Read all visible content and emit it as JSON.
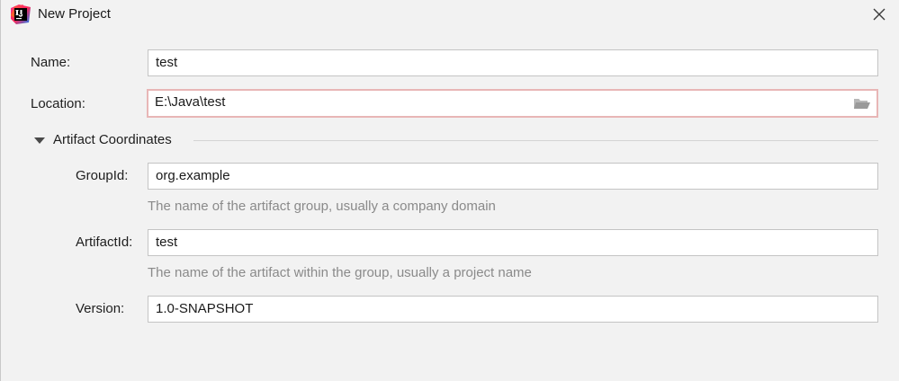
{
  "window": {
    "title": "New Project",
    "app_icon": "intellij-idea-icon",
    "close_icon": "close-icon"
  },
  "form": {
    "name": {
      "label": "Name:",
      "value": "test"
    },
    "location": {
      "label": "Location:",
      "value": "E:\\Java\\test",
      "browse_icon": "folder-open-icon"
    },
    "artifact_section": {
      "title": "Artifact Coordinates",
      "expanded": true,
      "group_id": {
        "label": "GroupId:",
        "value": "org.example",
        "hint": "The name of the artifact group, usually a company domain"
      },
      "artifact_id": {
        "label": "ArtifactId:",
        "value": "test",
        "hint": "The name of the artifact within the group, usually a project name"
      },
      "version": {
        "label": "Version:",
        "value": "1.0-SNAPSHOT"
      }
    }
  },
  "colors": {
    "focus_border": "#e8b6b6",
    "hint_text": "#8a8a8a",
    "background": "#f2f2f2"
  }
}
